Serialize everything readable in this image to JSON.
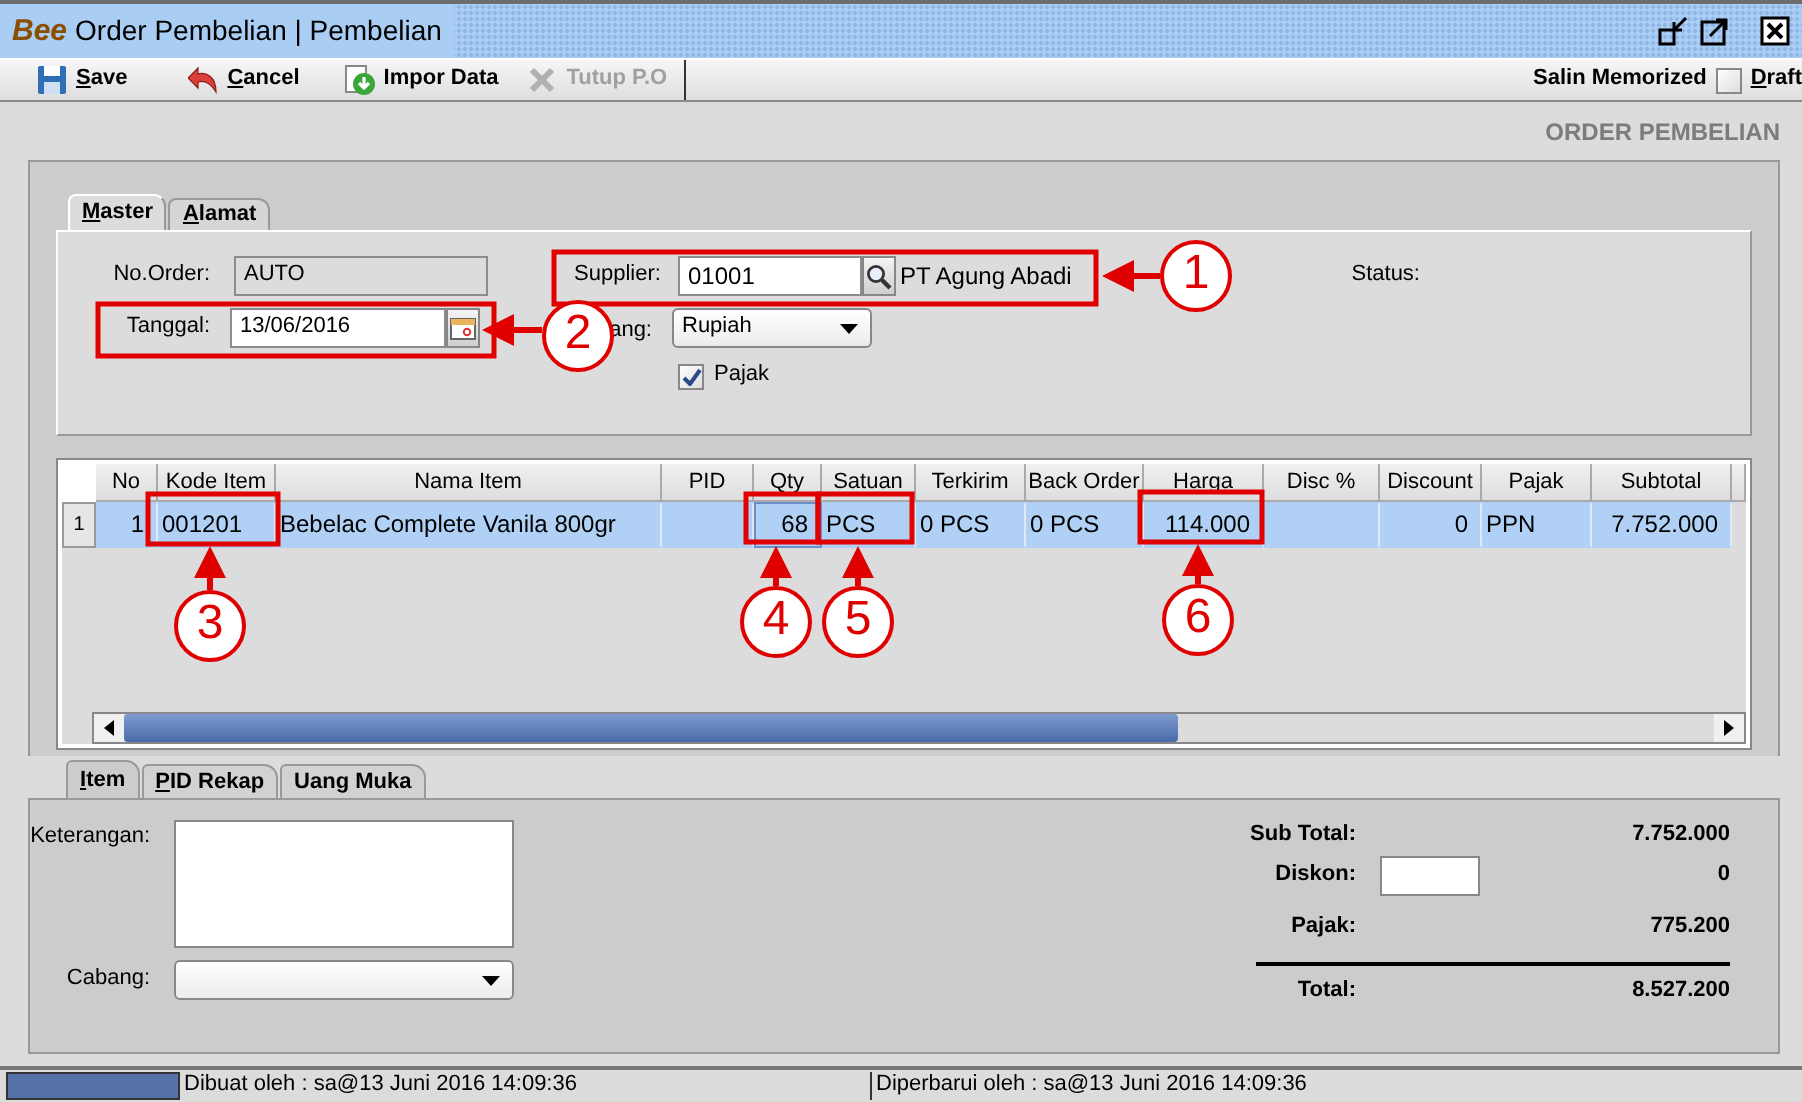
{
  "window": {
    "logo": "Bee",
    "title": "Order Pembelian | Pembelian"
  },
  "toolbar": {
    "buttons": [
      {
        "label": "Save",
        "disabled": false,
        "underline_first": true
      },
      {
        "label": "Cancel",
        "disabled": false,
        "underline_first": true
      },
      {
        "label": "Impor Data",
        "disabled": false,
        "underline_first": false
      },
      {
        "label": "Tutup P.O",
        "disabled": true,
        "underline_first": false
      }
    ],
    "memorize": {
      "label": "Salin Memorized",
      "checked": false
    },
    "draft": {
      "label": "Draft",
      "underline_first": true
    }
  },
  "heading": "ORDER PEMBELIAN",
  "master": {
    "tabs": [
      {
        "label": "Master",
        "selected": true,
        "underline_first": true
      },
      {
        "label": "Alamat",
        "selected": false,
        "underline_first": true
      }
    ],
    "no_order": {
      "label": "No.Order:",
      "value": "AUTO",
      "disabled": true
    },
    "supplier": {
      "label": "Supplier:",
      "value": "01001",
      "name": "PT Agung Abadi"
    },
    "status": {
      "label": "Status:"
    },
    "tanggal": {
      "label": "Tanggal:",
      "value": "13/06/2016"
    },
    "currency": {
      "label": "ang:",
      "value": "Rupiah"
    },
    "pajak": {
      "label": "Pajak",
      "checked": true
    }
  },
  "grid": {
    "columns": [
      {
        "label": "No",
        "kind": "number"
      },
      {
        "label": "Kode Item",
        "kind": "text"
      },
      {
        "label": "Nama Item",
        "kind": "text"
      },
      {
        "label": "PID",
        "kind": "text"
      },
      {
        "label": "Qty",
        "kind": "number"
      },
      {
        "label": "Satuan",
        "kind": "text"
      },
      {
        "label": "Terkirim",
        "kind": "text"
      },
      {
        "label": "Back Order",
        "kind": "text"
      },
      {
        "label": "Harga",
        "kind": "number"
      },
      {
        "label": "Disc %",
        "kind": "number"
      },
      {
        "label": "Discount",
        "kind": "number"
      },
      {
        "label": "Pajak",
        "kind": "text"
      },
      {
        "label": "Subtotal",
        "kind": "number"
      }
    ],
    "rows": [
      {
        "row_header": "1",
        "selected": true,
        "cells": [
          {
            "text": "1",
            "focused": false
          },
          {
            "text": "001201",
            "focused": false
          },
          {
            "text": "Bebelac Complete Vanila 800gr",
            "focused": false
          },
          {
            "focused": false
          },
          {
            "text": "68",
            "focused": true
          },
          {
            "text": "PCS",
            "focused": false
          },
          {
            "text": "0 PCS",
            "focused": false
          },
          {
            "text": "0 PCS",
            "focused": false
          },
          {
            "text": "114.000",
            "focused": false
          },
          {
            "focused": false
          },
          {
            "text": "0",
            "focused": false
          },
          {
            "text": "PPN",
            "focused": false
          },
          {
            "text": "7.752.000",
            "focused": false
          }
        ]
      }
    ]
  },
  "detail_tabs": [
    {
      "label": "Item",
      "selected": true,
      "underline_first": true
    },
    {
      "label": "PID Rekap",
      "selected": false,
      "underline_first": true
    },
    {
      "label": "Uang Muka",
      "selected": false,
      "underline_first": false
    }
  ],
  "notes": {
    "label": "Keterangan:"
  },
  "branch": {
    "label": "Cabang:"
  },
  "totals": [
    {
      "label": "Sub Total:",
      "value": "7.752.000",
      "kind": "plain"
    },
    {
      "label": "Diskon:",
      "value": "0",
      "kind": "input"
    },
    {
      "label": "Pajak:",
      "value": "775.200",
      "kind": "plain"
    },
    {
      "label": "Total:",
      "value": "8.527.200",
      "kind": "total"
    }
  ],
  "status_bar": {
    "created": "Dibuat oleh : sa@13 Juni 2016  14:09:36",
    "updated": "Diperbarui oleh : sa@13 Juni 2016  14:09:36"
  },
  "annotations": [
    {
      "number": "1"
    },
    {
      "number": "2"
    },
    {
      "number": "3"
    },
    {
      "number": "4"
    },
    {
      "number": "5"
    },
    {
      "number": "6"
    }
  ]
}
